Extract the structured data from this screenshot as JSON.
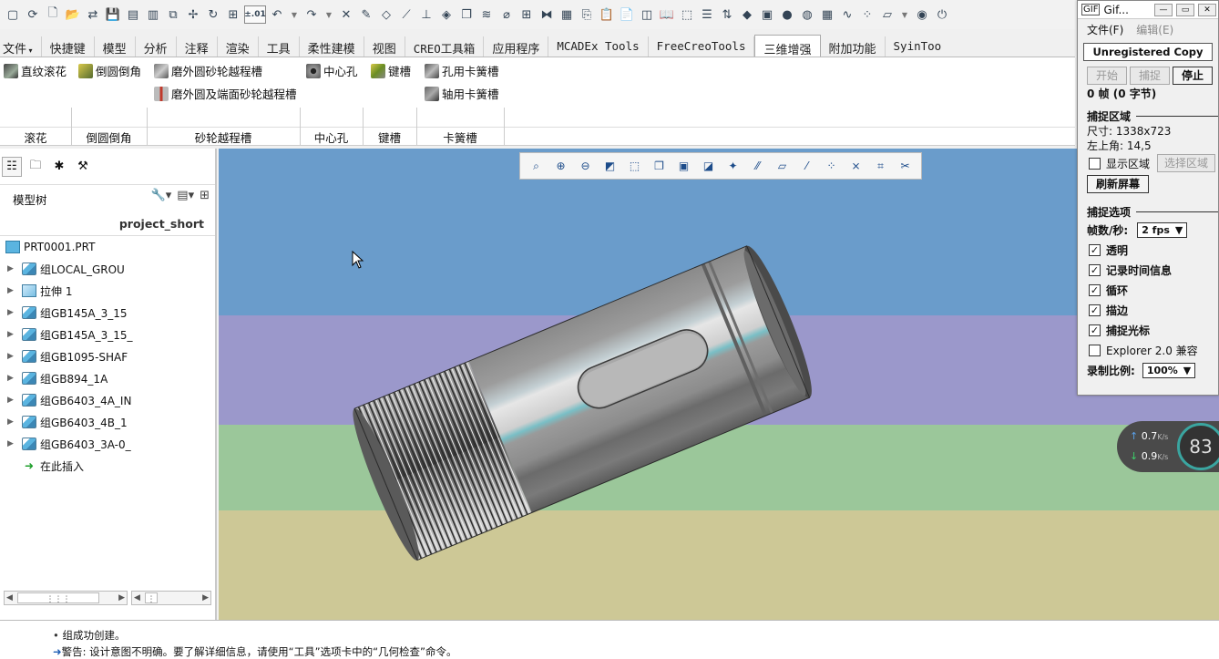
{
  "quick_toolbar": {
    "zoom_precision_label": "±.01"
  },
  "tabs": [
    "文件",
    "快捷键",
    "模型",
    "分析",
    "注释",
    "渲染",
    "工具",
    "柔性建模",
    "视图",
    "CREO工具箱",
    "应用程序",
    "MCADEx Tools",
    "FreeCreoTools",
    "三维增强",
    "附加功能",
    "SyinToo"
  ],
  "ribbon": {
    "buttons": {
      "knurl": "直纹滚花",
      "fillet_chamfer": "倒圆倒角",
      "grind_groove": "磨外圆砂轮越程槽",
      "grind_face_groove": "磨外圆及端面砂轮越程槽",
      "center_hole": "中心孔",
      "keyway": "键槽",
      "hole_circlip": "孔用卡簧槽",
      "shaft_circlip": "轴用卡簧槽"
    },
    "groups": {
      "knurl": "滚花",
      "fillet": "倒圆倒角",
      "groove": "砂轮越程槽",
      "center": "中心孔",
      "key": "键槽",
      "circlip": "卡簧槽"
    }
  },
  "model_tree": {
    "title": "模型树",
    "column_header": "project_short",
    "items": [
      {
        "label": "PRT0001.PRT"
      },
      {
        "label": "组LOCAL_GROU"
      },
      {
        "label": "拉伸 1"
      },
      {
        "label": "组GB145A_3_15"
      },
      {
        "label": "组GB145A_3_15_"
      },
      {
        "label": "组GB1095-SHAF"
      },
      {
        "label": "组GB894_1A"
      },
      {
        "label": "组GB6403_4A_IN"
      },
      {
        "label": "组GB6403_4B_1"
      },
      {
        "label": "组GB6403_3A-0_"
      },
      {
        "label": "在此插入"
      }
    ]
  },
  "status": {
    "line1": "组成功创建。",
    "line2": "警告: 设计意图不明确。要了解详细信息，请使用“工具”选项卡中的“几何检查”命令。"
  },
  "gifcam": {
    "title": "Gif...",
    "menu_file": "文件(F)",
    "menu_edit": "编辑(E)",
    "banner": "Unregistered Copy",
    "btn_start": "开始",
    "btn_capture": "捕捉",
    "btn_stop": "停止",
    "frames": "0 帧 (0 字节)",
    "section_area": "捕捉区域",
    "size": "尺寸: 1338x723",
    "topleft": "左上角: 14,5",
    "show_area": "显示区域",
    "select_area": "选择区域",
    "refresh": "刷新屏幕",
    "section_options": "捕捉选项",
    "fps_label": "帧数/秒:",
    "fps_value": "2 fps",
    "opt_transparent": "透明",
    "opt_timestamp": "记录时间信息",
    "opt_loop": "循环",
    "opt_outline": "描边",
    "opt_cursor": "捕捉光标",
    "opt_explorer": "Explorer 2.0 兼容",
    "scale_label": "录制比例:",
    "scale_value": "100%"
  },
  "speed_widget": {
    "up": "0.7",
    "down": "0.9",
    "unit": "K/s",
    "percent": "83"
  },
  "colors": {
    "sky": "#6a9ccb",
    "band_purple": "#9b98cb",
    "band_green": "#9bc79a",
    "ground": "#cdc896",
    "accent_blue": "#1f5fb5"
  }
}
